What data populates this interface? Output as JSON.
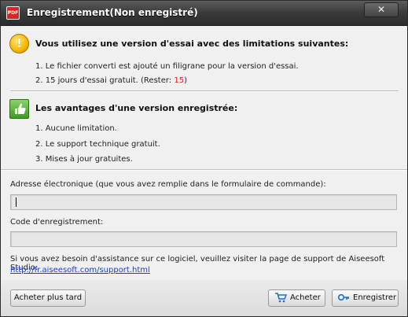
{
  "window": {
    "title": "Enregistrement(Non enregistré)",
    "close_label": "✕"
  },
  "app_icon_text": "PDF",
  "trial": {
    "heading": "Vous utilisez une version d'essai avec des limitations suivantes:",
    "items": [
      "1. Le fichier converti est ajouté un filigrane pour la version d'essai.",
      "2. 15 jours d'essai gratuit. (Rester: "
    ],
    "remaining_days": "15",
    "remaining_suffix": ")"
  },
  "benefits": {
    "heading": "Les avantages d'une version enregistrée:",
    "items": [
      "1. Aucune limitation.",
      "2. Le support technique gratuit.",
      "3. Mises à jour gratuites."
    ]
  },
  "form": {
    "email_label": "Adresse électronique (que vous avez remplie dans le formulaire de commande):",
    "email_value": "",
    "code_label": "Code d'enregistrement:",
    "code_value": ""
  },
  "support": {
    "text": "Si vous avez besoin d'assistance sur ce logiciel, veuillez visiter la page de support de Aiseesoft Studio:",
    "link": "http://fr.aiseesoft.com/support.html"
  },
  "buttons": {
    "later": "Acheter plus tard",
    "buy": "Acheter",
    "register": "Enregistrer"
  },
  "icons": {
    "warning": "warning-icon",
    "thumbs_up": "thumbs-up-icon",
    "cart": "cart-icon",
    "key": "key-icon",
    "app": "pdf-app-icon",
    "close": "close-icon"
  },
  "colors": {
    "remaining": "#e02020",
    "link": "#1a3fd8",
    "titlebar": "#3a3a3a"
  }
}
